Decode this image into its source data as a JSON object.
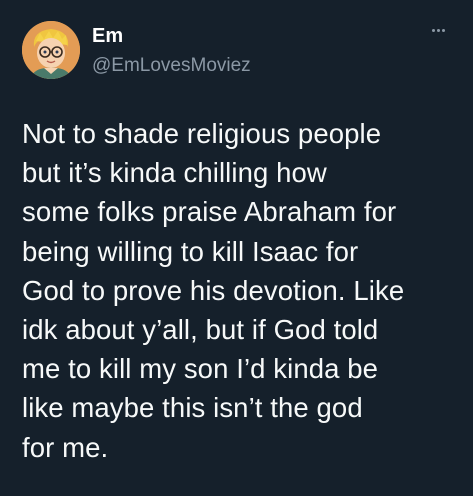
{
  "author": {
    "display_name": "Em",
    "handle": "@EmLovesMoviez",
    "avatar_icon": "cartoon-boy-avatar-icon"
  },
  "menu": {
    "icon": "more-options-icon"
  },
  "tweet": {
    "lines": [
      "Not to shade religious people",
      "but it’s kinda chilling how",
      "some folks praise Abraham for",
      "being willing to kill Isaac for",
      "God to prove his devotion. Like",
      "idk about y’all, but if God told",
      "me to kill my son I’d kinda be",
      "like maybe this isn’t the god",
      "for me."
    ]
  },
  "colors": {
    "background": "#15202b",
    "text": "#f7f9f9",
    "secondary": "#8b98a5"
  }
}
